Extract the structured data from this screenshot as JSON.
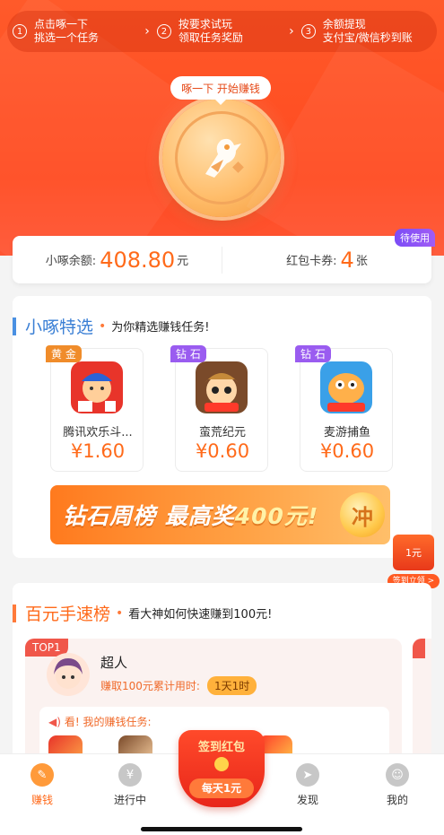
{
  "steps": [
    {
      "num": "1",
      "line1": "点击啄一下",
      "line2": "挑选一个任务"
    },
    {
      "num": "2",
      "line1": "按要求试玩",
      "line2": "领取任务奖励"
    },
    {
      "num": "3",
      "line1": "余额提现",
      "line2": "支付宝/微信秒到账"
    }
  ],
  "hero": {
    "start_label": "啄一下 开始赚钱"
  },
  "balance": {
    "label": "小啄余额:",
    "value": "408.80",
    "unit": "元",
    "coupon_label": "红包卡券:",
    "coupon_value": "4",
    "coupon_unit": "张",
    "pending_tag": "待使用"
  },
  "featured": {
    "title": "小啄特选",
    "subtitle": "为你精选赚钱任务!",
    "games": [
      {
        "tier": "黄 金",
        "name": "腾讯欢乐斗...",
        "price": "¥1.60"
      },
      {
        "tier": "钻 石",
        "name": "蛮荒纪元",
        "price": "¥0.60"
      },
      {
        "tier": "钻 石",
        "name": "麦游捕鱼",
        "price": "¥0.60"
      }
    ],
    "banner_text_a": "钻石周榜 最高奖",
    "banner_text_b": "400元!",
    "banner_button": "冲"
  },
  "float_widget": {
    "amount": "1元",
    "label": "签到立领 >"
  },
  "ranking": {
    "title": "百元手速榜",
    "subtitle": "看大神如何快速赚到100元!",
    "badge": "TOP1",
    "user_name": "超人",
    "earn_label": "赚取100元累计用时:",
    "earn_time": "1天1时",
    "task_head": "看! 我的赚钱任务:"
  },
  "nav": {
    "items": [
      {
        "label": "赚钱"
      },
      {
        "label": "进行中"
      },
      {
        "label": "发现"
      },
      {
        "label": "我的"
      }
    ],
    "center_title": "签到红包",
    "center_sub": "每天1元"
  },
  "colors": {
    "brand": "#ff5a2a",
    "accent": "#ff6a1a",
    "purple": "#9a5cf0",
    "blue": "#3a7fd5"
  }
}
